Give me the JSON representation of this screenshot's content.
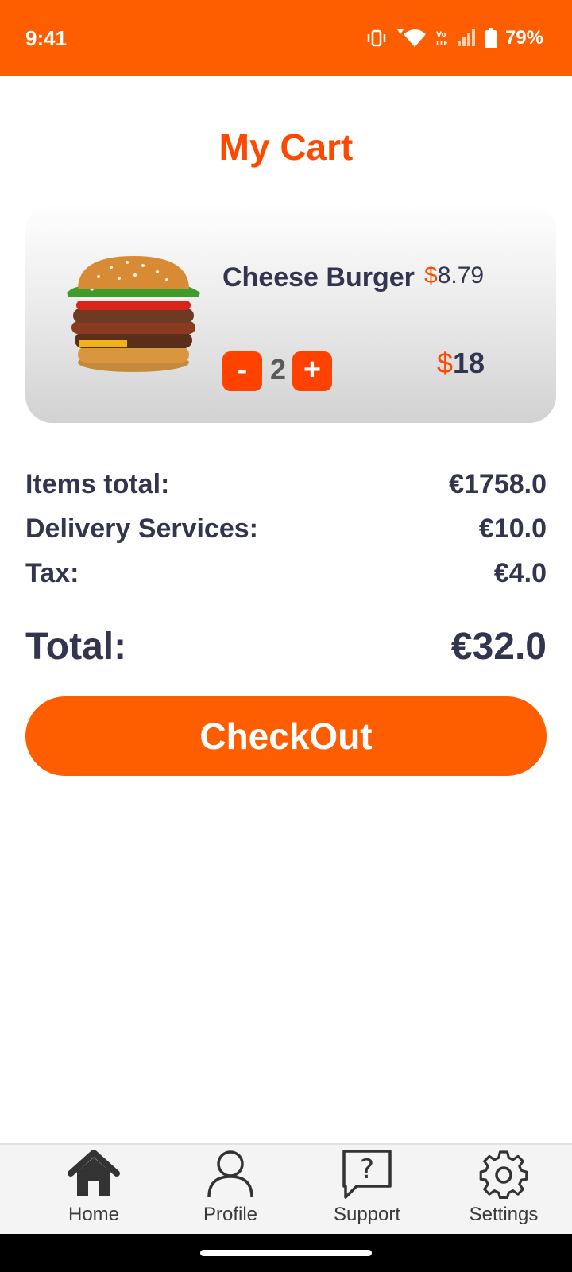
{
  "status_bar": {
    "time": "9:41",
    "battery": "79%",
    "icons": [
      "vibrate-icon",
      "wifi-icon",
      "volte-icon",
      "signal-icon",
      "battery-icon"
    ]
  },
  "page": {
    "title": "My Cart"
  },
  "cart": {
    "items": [
      {
        "name": "Cheese Burger",
        "price_symbol": "$",
        "price": "8.79",
        "quantity": "2",
        "total_symbol": "$",
        "total": "18",
        "minus_label": "-",
        "plus_label": "+",
        "image": "burger-image"
      }
    ]
  },
  "summary": {
    "items_total_label": "Items total:",
    "items_total_value": "€1758.0",
    "delivery_label": "Delivery Services:",
    "delivery_value": "€10.0",
    "tax_label": "Tax:",
    "tax_value": "€4.0",
    "total_label": "Total:",
    "total_value": "€32.0"
  },
  "checkout": {
    "label": "CheckOut"
  },
  "bottom_nav": {
    "items": [
      {
        "label": "Home",
        "icon": "home-icon"
      },
      {
        "label": "Profile",
        "icon": "profile-icon"
      },
      {
        "label": "Support",
        "icon": "support-icon"
      },
      {
        "label": "Settings",
        "icon": "settings-icon"
      }
    ]
  },
  "colors": {
    "accent": "#ff5e00",
    "title": "#ff4800",
    "text": "#33354f"
  }
}
